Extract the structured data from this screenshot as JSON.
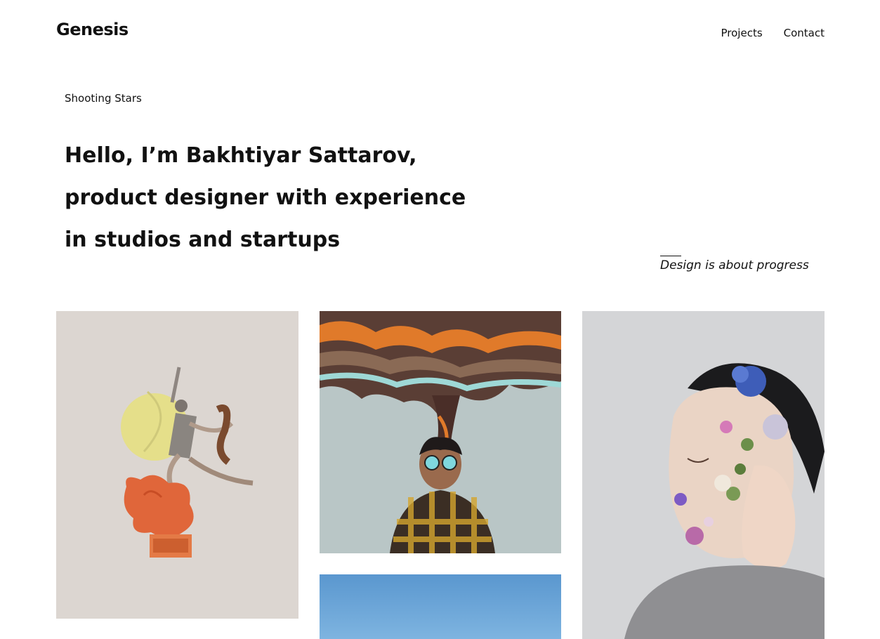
{
  "brand": {
    "name": "Genesis"
  },
  "nav": {
    "projects": "Projects",
    "contact": "Contact"
  },
  "section": {
    "label": "Shooting Stars"
  },
  "hero": {
    "line1": "Hello, I’m Bakhtiyar Sattarov,",
    "line2": "product designer with experience",
    "line3": "in studios and startups"
  },
  "tagline": "Design is about progress",
  "gallery": [
    {
      "subject": "dancer-collage"
    },
    {
      "subject": "man-with-smoke-illustration"
    },
    {
      "subject": "man-with-flowers-on-face"
    },
    {
      "subject": "blue-sky"
    }
  ]
}
